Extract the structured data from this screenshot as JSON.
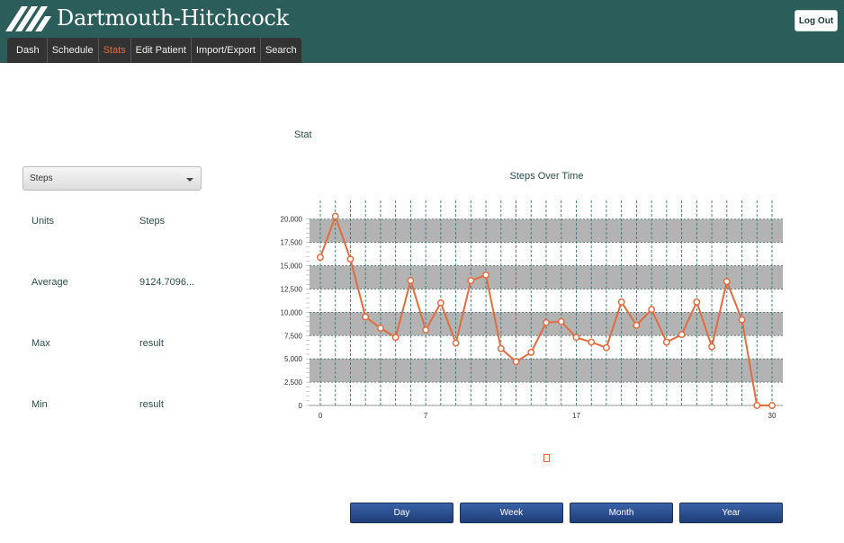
{
  "header": {
    "brand": "Dartmouth-Hitchcock",
    "logout_label": "Log Out"
  },
  "nav": {
    "tabs": [
      {
        "label": "Dash"
      },
      {
        "label": "Schedule"
      },
      {
        "label": "Stats"
      },
      {
        "label": "Edit Patient"
      },
      {
        "label": "Import/Export"
      },
      {
        "label": "Search"
      }
    ],
    "active": "Stats"
  },
  "stat_heading": "Stat",
  "metric_select": {
    "value": "Steps"
  },
  "stats": [
    {
      "label": "Units",
      "value": "Steps"
    },
    {
      "label": "Average",
      "value": "9124.7096..."
    },
    {
      "label": "Max",
      "value": "result"
    },
    {
      "label": "Min",
      "value": "result"
    }
  ],
  "colors": {
    "header_bg": "#2b5d5b",
    "accent": "#e06d3f",
    "text": "#2a4f4c",
    "band": "#b3b3b3",
    "button": "#2a4d8f"
  },
  "chart_data": {
    "type": "line",
    "title": "Steps Over Time",
    "x": [
      0,
      1,
      2,
      3,
      4,
      5,
      6,
      7,
      8,
      9,
      10,
      11,
      12,
      13,
      14,
      15,
      16,
      17,
      18,
      19,
      20,
      21,
      22,
      23,
      24,
      25,
      26,
      27,
      28,
      29,
      30
    ],
    "series": [
      {
        "values": [
          15900,
          20300,
          15700,
          9500,
          8300,
          7300,
          13400,
          8100,
          11000,
          6700,
          13400,
          14000,
          6100,
          4700,
          5700,
          8900,
          9000,
          7300,
          6800,
          6200,
          11100,
          8600,
          10300,
          6800,
          7600,
          11100,
          6300,
          13300,
          9200,
          0,
          0
        ]
      }
    ],
    "x_ticks": [
      0,
      7,
      17,
      30
    ],
    "y_ticks": [
      0,
      2500,
      5000,
      7500,
      10000,
      12500,
      15000,
      17500,
      20000
    ],
    "y_tick_labels": [
      "0",
      "2,500",
      "5,000",
      "7,500",
      "10,000",
      "12,500",
      "15,000",
      "17,500",
      "20,000"
    ],
    "xlim": [
      0,
      30
    ],
    "ylim": [
      0,
      22000
    ],
    "grid": true
  },
  "range_buttons": [
    {
      "label": "Day"
    },
    {
      "label": "Week"
    },
    {
      "label": "Month"
    },
    {
      "label": "Year"
    }
  ]
}
